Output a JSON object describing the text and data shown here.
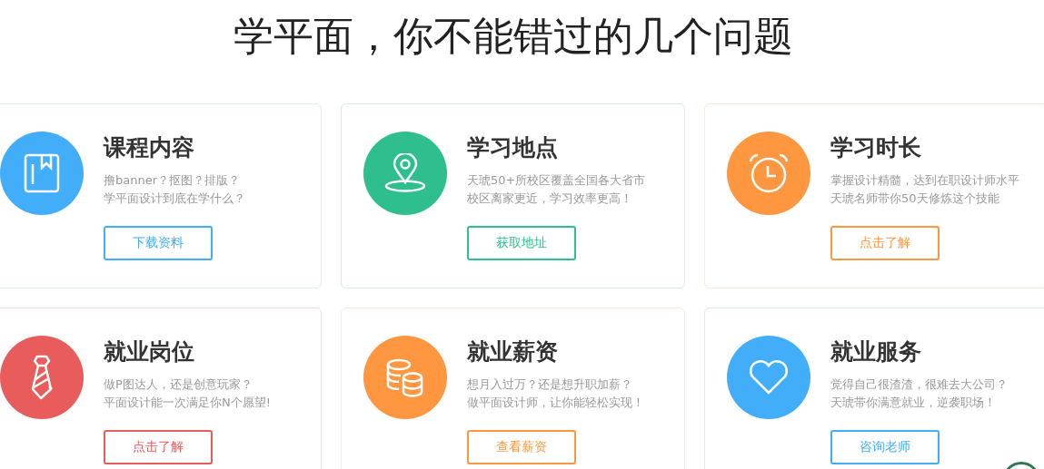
{
  "heading": "学平面，你不能错过的几个问题",
  "cards": [
    {
      "kind": "book",
      "color": "#42adf9",
      "title": "课程内容",
      "lines": [
        "撸banner？抠图？排版？",
        "学平面设计到底在学什么？"
      ],
      "button": "下载资料"
    },
    {
      "kind": "pin",
      "color": "#2fbf8f",
      "title": "学习地点",
      "lines": [
        "天琥50+所校区覆盖全国各大省市",
        "校区离家更近，学习效率更高！"
      ],
      "button": "获取地址"
    },
    {
      "kind": "clock",
      "color": "#ff9640",
      "title": "学习时长",
      "lines": [
        "掌握设计精髓，达到在职设计师水平",
        "天琥名师带你50天修炼这个技能"
      ],
      "button": "点击了解"
    },
    {
      "kind": "tie",
      "color": "#e85c5c",
      "title": "就业岗位",
      "lines": [
        "做P图达人，还是创意玩家？",
        "平面设计能一次满足你N个愿望!"
      ],
      "button": "点击了解"
    },
    {
      "kind": "coins",
      "color": "#ff9640",
      "title": "就业薪资",
      "lines": [
        "想月入过万？还是想升职加薪？",
        "做平面设计师，让你能轻松实现！"
      ],
      "button": "查看薪资"
    },
    {
      "kind": "heart",
      "color": "#42adf9",
      "title": "就业服务",
      "lines": [
        "觉得自己很渣渣，很难去大公司？",
        "天琥带你满意就业，逆袭职场！"
      ],
      "button": "咨询老师"
    }
  ]
}
